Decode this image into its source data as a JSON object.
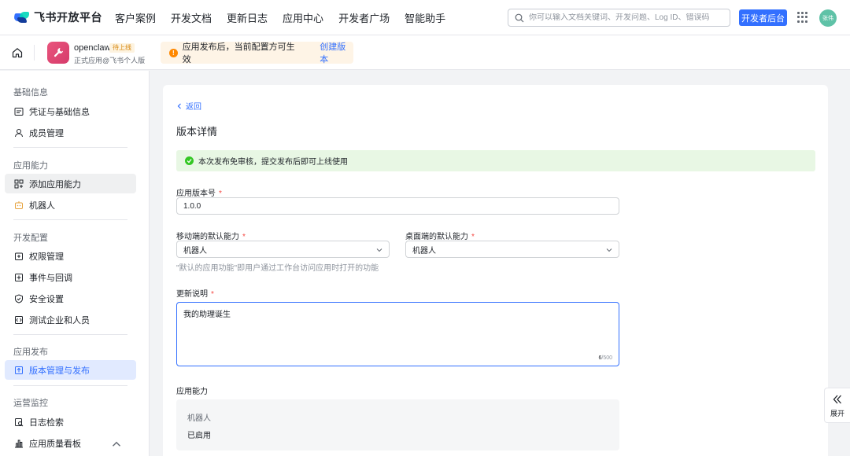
{
  "topnav": {
    "logo_text": "飞书开放平台",
    "links": [
      "客户案例",
      "开发文档",
      "更新日志",
      "应用中心",
      "开发者广场",
      "智能助手"
    ],
    "search_placeholder": "你可以输入文档关键词、开发问题、Log ID、错误码",
    "dev_console_label": "开发者后台",
    "avatar_text": "张伟",
    "brand_color": "#3370ff"
  },
  "appbar": {
    "app_name": "openclaw",
    "app_status": "待上线",
    "app_subtitle": "正式应用@飞书个人版",
    "notice_text": "应用发布后，当前配置方可生效",
    "notice_link": "创建版本"
  },
  "sidebar": {
    "sections": [
      {
        "title": "基础信息",
        "items": [
          {
            "label": "凭证与基础信息",
            "icon": "credential-icon"
          },
          {
            "label": "成员管理",
            "icon": "user-icon"
          }
        ]
      },
      {
        "title": "应用能力",
        "items": [
          {
            "label": "添加应用能力",
            "icon": "grid-plus-icon"
          },
          {
            "label": "机器人",
            "icon": "robot-icon"
          }
        ]
      },
      {
        "title": "开发配置",
        "items": [
          {
            "label": "权限管理",
            "icon": "lock-icon"
          },
          {
            "label": "事件与回调",
            "icon": "event-icon"
          },
          {
            "label": "安全设置",
            "icon": "shield-icon"
          },
          {
            "label": "测试企业和人员",
            "icon": "test-icon"
          }
        ]
      },
      {
        "title": "应用发布",
        "items": [
          {
            "label": "版本管理与发布",
            "icon": "upload-icon"
          }
        ]
      },
      {
        "title": "运营监控",
        "items": [
          {
            "label": "日志检索",
            "icon": "log-search-icon"
          },
          {
            "label": "应用质量看板",
            "icon": "chart-icon"
          }
        ]
      }
    ]
  },
  "main": {
    "back_label": "返回",
    "title": "版本详情",
    "success_text": "本次发布免审核，提交发布后即可上线使用",
    "version_label": "应用版本号",
    "version_value": "1.0.0",
    "mobile_default_label": "移动端的默认能力",
    "mobile_default_value": "机器人",
    "desktop_default_label": "桌面端的默认能力",
    "desktop_default_value": "机器人",
    "default_hint": "\"默认的应用功能\"即用户通过工作台访问应用时打开的功能",
    "release_notes_label": "更新说明",
    "release_notes_value": "我的助理诞生",
    "char_count": "6",
    "char_limit": "/500",
    "capabilities_label": "应用能力",
    "capability_name": "机器人",
    "capability_status": "已启用",
    "required_mark": "*"
  },
  "expand": {
    "label": "展开"
  }
}
